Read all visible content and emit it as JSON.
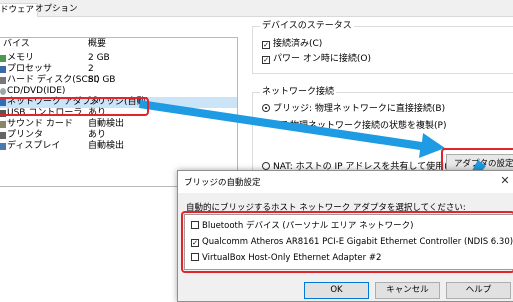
{
  "tabs": [
    {
      "label": "ドウェア"
    },
    {
      "label": "オプション"
    }
  ],
  "device_list": {
    "headers": {
      "device": "バイス",
      "summary": "概要"
    },
    "rows": [
      {
        "name": "メモリ",
        "summary": "2 GB",
        "icon": "memory-icon"
      },
      {
        "name": "プロセッサ",
        "summary": "2",
        "icon": "processor-icon"
      },
      {
        "name": "ハード ディスク(SCSI)",
        "summary": "80 GB",
        "icon": "harddisk-icon"
      },
      {
        "name": "CD/DVD(IDE)",
        "summary": "",
        "icon": "cd-dvd-icon"
      },
      {
        "name": "ネットワーク アダプタ",
        "summary": "ブリッジ(自動)",
        "icon": "network-adapter-icon",
        "selected": true
      },
      {
        "name": "USB コントローラ",
        "summary": "あり",
        "icon": "usb-icon"
      },
      {
        "name": "サウンド カード",
        "summary": "自動検出",
        "icon": "sound-icon"
      },
      {
        "name": "プリンタ",
        "summary": "あり",
        "icon": "printer-icon"
      },
      {
        "name": "ディスプレイ",
        "summary": "自動検出",
        "icon": "display-icon"
      }
    ]
  },
  "device_status": {
    "title": "デバイスのステータス",
    "connected": "接続済み(C)",
    "connect_at_power_on": "パワー オン時に接続(O)"
  },
  "network_connection": {
    "title": "ネットワーク接続",
    "bridged": "ブリッジ: 物理ネットワークに直接接続(B)",
    "replicate": "物理ネットワーク接続の状態を複製(P)",
    "nat": "NAT: ホストの IP アドレスを共有して使用(N)",
    "configure_button": "アダプタの設定(A)..."
  },
  "dialog": {
    "title": "ブリッジの自動設定",
    "instruction": "自動的にブリッジするホスト ネットワーク アダプタを選択してください:",
    "adapters": [
      {
        "label": "Bluetooth デバイス (パーソナル エリア ネットワーク)",
        "checked": false
      },
      {
        "label": "Qualcomm Atheros AR8161 PCI-E Gigabit Ethernet Controller (NDIS 6.30)",
        "checked": true
      },
      {
        "label": "VirtualBox Host-Only Ethernet Adapter #2",
        "checked": false
      }
    ],
    "buttons": {
      "ok": "OK",
      "cancel": "キャンセル",
      "help": "ヘルプ"
    }
  },
  "colors": {
    "highlight": "#e2242c",
    "arrow": "#1e9be3",
    "selection": "#cce4f7"
  }
}
